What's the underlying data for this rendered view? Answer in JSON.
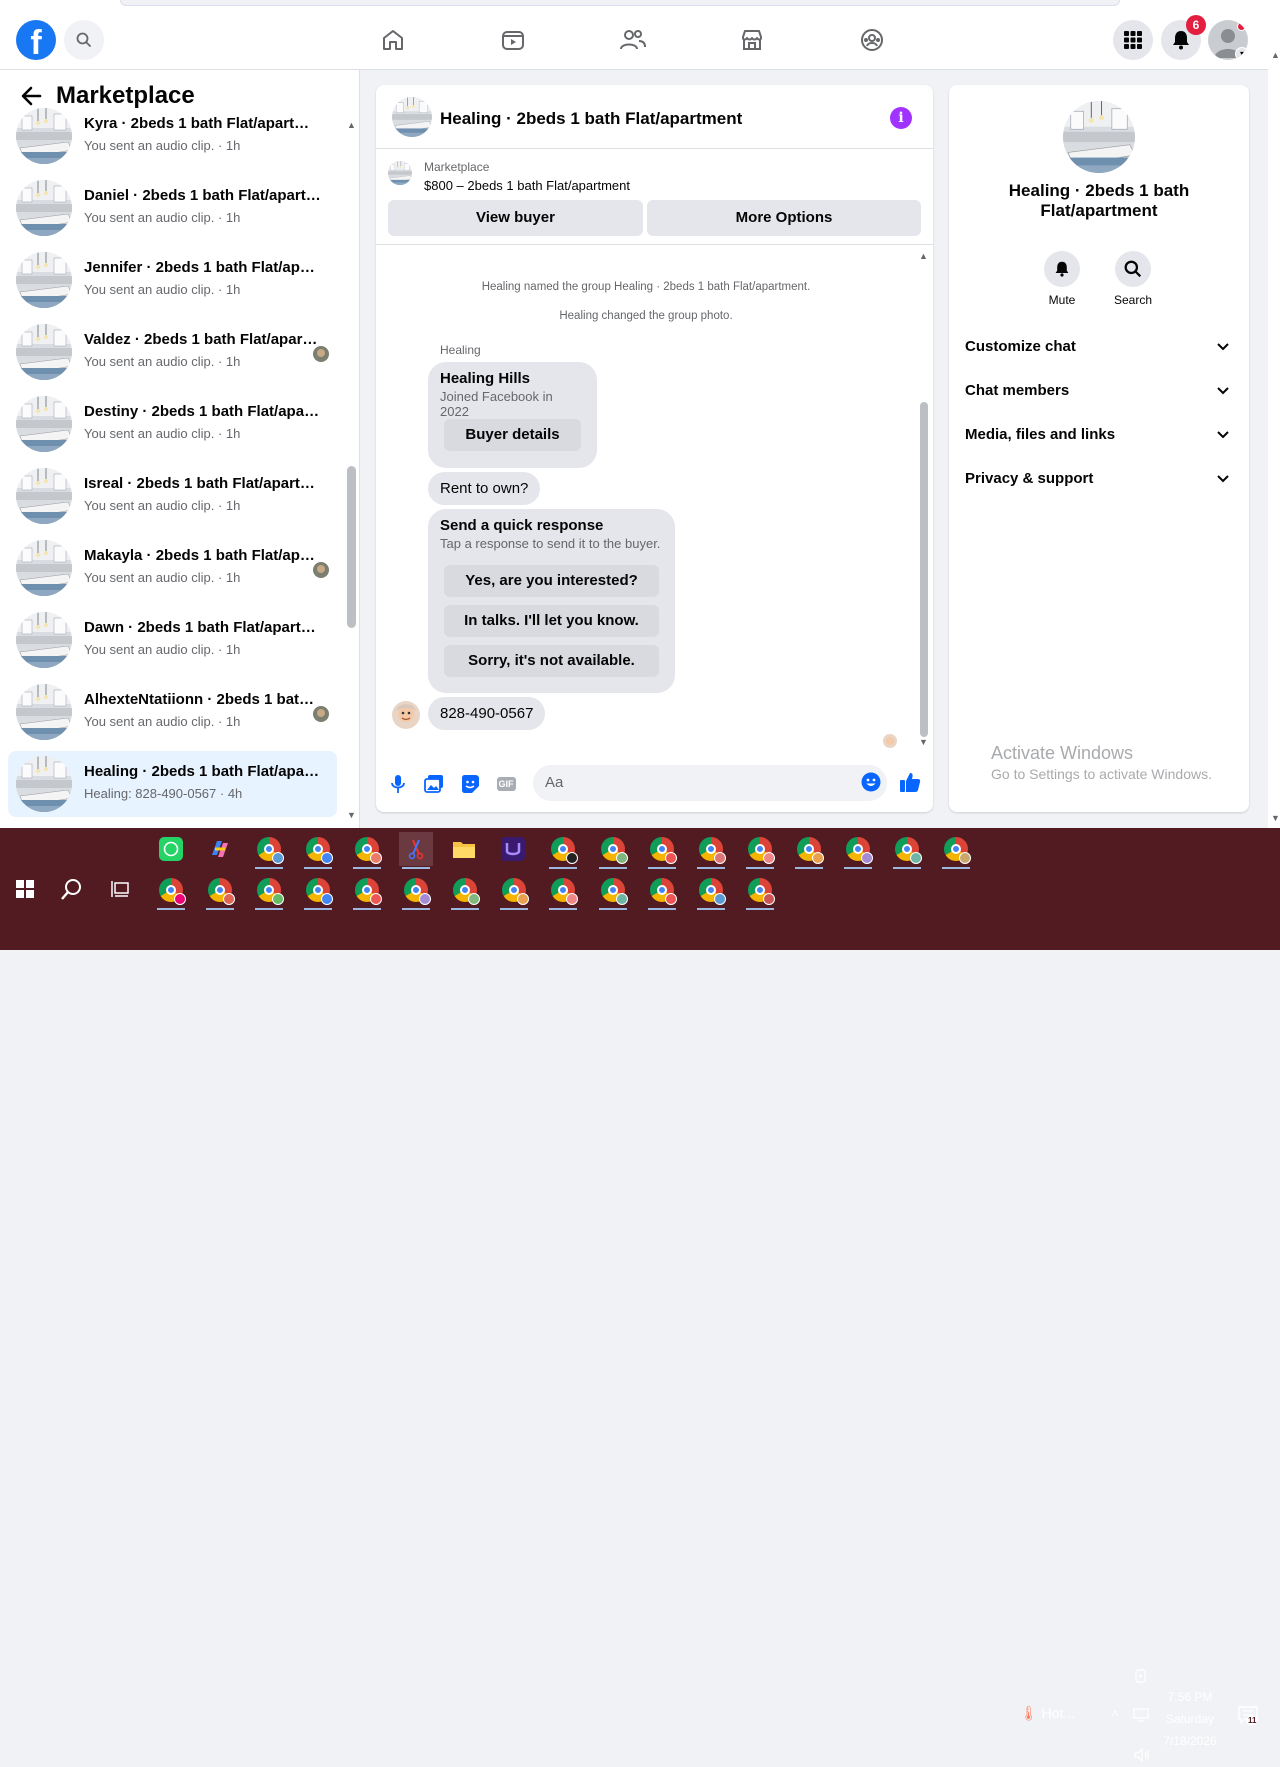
{
  "header": {
    "logo": "f",
    "notification_count": "6"
  },
  "left_panel": {
    "title": "Marketplace",
    "conversations": [
      {
        "name": "Kyra · 2beds 1 bath Flat/apartment",
        "snippet": "You sent an audio clip. · 1h",
        "mini": false
      },
      {
        "name": "Daniel · 2beds 1 bath Flat/apartment",
        "snippet": "You sent an audio clip. · 1h",
        "mini": false
      },
      {
        "name": "Jennifer · 2beds 1 bath Flat/apartment",
        "snippet": "You sent an audio clip. · 1h",
        "mini": false
      },
      {
        "name": "Valdez · 2beds 1 bath Flat/apartment",
        "snippet": "You sent an audio clip. · 1h",
        "mini": true
      },
      {
        "name": "Destiny · 2beds 1 bath Flat/apartment",
        "snippet": "You sent an audio clip. · 1h",
        "mini": false
      },
      {
        "name": "Isreal · 2beds 1 bath Flat/apartment",
        "snippet": "You sent an audio clip. · 1h",
        "mini": false
      },
      {
        "name": "Makayla · 2beds 1 bath Flat/apartment",
        "snippet": "You sent an audio clip. · 1h",
        "mini": true
      },
      {
        "name": "Dawn · 2beds 1 bath Flat/apartment",
        "snippet": "You sent an audio clip. · 1h",
        "mini": false
      },
      {
        "name": "AlhexteNtatiionn · 2beds 1 bath Flat/apartment",
        "snippet": "You sent an audio clip. · 1h",
        "mini": true
      },
      {
        "name": "Healing · 2beds 1 bath Flat/apartment",
        "snippet": "Healing: 828-490-0567 · 4h",
        "mini": false,
        "active": true
      }
    ]
  },
  "chat": {
    "title": "Healing · 2beds 1 bath Flat/apartment",
    "marketplace_label": "Marketplace",
    "listing": "$800 – 2beds 1 bath Flat/apartment",
    "view_buyer": "View buyer",
    "more_options": "More Options",
    "system_messages": [
      "Healing named the group Healing · 2beds 1 bath Flat/apartment.",
      "Healing changed the group photo."
    ],
    "sender": "Healing",
    "profile_card": {
      "name": "Healing Hills",
      "joined": "Joined Facebook in 2022",
      "button": "Buyer details"
    },
    "message_1": "Rent to own?",
    "quick_response": {
      "title": "Send a quick response",
      "subtitle": "Tap a response to send it to the buyer.",
      "options": [
        "Yes, are you interested?",
        "In talks. I'll let you know.",
        "Sorry, it's not available."
      ]
    },
    "message_2": "828-490-0567",
    "composer_placeholder": "Aa",
    "gif_label": "GIF"
  },
  "right_panel": {
    "title": "Healing · 2beds 1 bath Flat/apartment",
    "actions": [
      "Mute",
      "Search"
    ],
    "sections": [
      "Customize chat",
      "Chat members",
      "Media, files and links",
      "Privacy & support"
    ],
    "activate_title": "Activate Windows",
    "activate_sub": "Go to Settings to activate Windows."
  },
  "taskbar": {
    "weather": "Hot...",
    "time": "7:56 PM",
    "day": "Saturday",
    "date": "7/18/2026",
    "notif_count": "11"
  },
  "colors": {
    "brand": "#1877f2",
    "taskbar": "#521b22",
    "accent_purple": "#a033ff",
    "badge": "#e41e3f"
  }
}
